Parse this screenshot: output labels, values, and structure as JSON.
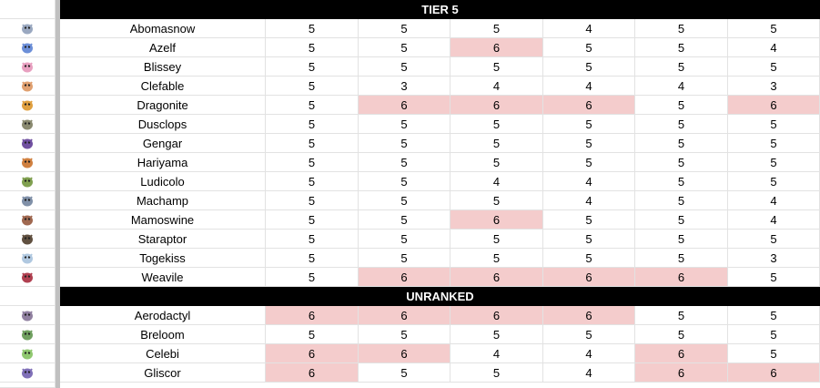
{
  "sections": [
    {
      "title": "TIER 5",
      "rows": [
        {
          "name": "Abomasnow",
          "icon": "abomasnow-icon",
          "color": "#9aa8c0",
          "values": [
            "5",
            "5",
            "5",
            "4",
            "5",
            "5"
          ],
          "highlight": [
            false,
            false,
            false,
            false,
            false,
            false
          ]
        },
        {
          "name": "Azelf",
          "icon": "azelf-icon",
          "color": "#6c8fd8",
          "values": [
            "5",
            "5",
            "6",
            "5",
            "5",
            "4"
          ],
          "highlight": [
            false,
            false,
            true,
            false,
            false,
            false
          ]
        },
        {
          "name": "Blissey",
          "icon": "blissey-icon",
          "color": "#e8a0c0",
          "values": [
            "5",
            "5",
            "5",
            "5",
            "5",
            "5"
          ],
          "highlight": [
            false,
            false,
            false,
            false,
            false,
            false
          ]
        },
        {
          "name": "Clefable",
          "icon": "clefable-icon",
          "color": "#e0a070",
          "values": [
            "5",
            "3",
            "4",
            "4",
            "4",
            "3"
          ],
          "highlight": [
            false,
            false,
            false,
            false,
            false,
            false
          ]
        },
        {
          "name": "Dragonite",
          "icon": "dragonite-icon",
          "color": "#e0a040",
          "values": [
            "5",
            "6",
            "6",
            "6",
            "5",
            "6"
          ],
          "highlight": [
            false,
            true,
            true,
            true,
            false,
            true
          ]
        },
        {
          "name": "Dusclops",
          "icon": "dusclops-icon",
          "color": "#8a8a70",
          "values": [
            "5",
            "5",
            "5",
            "5",
            "5",
            "5"
          ],
          "highlight": [
            false,
            false,
            false,
            false,
            false,
            false
          ]
        },
        {
          "name": "Gengar",
          "icon": "gengar-icon",
          "color": "#7050a0",
          "values": [
            "5",
            "5",
            "5",
            "5",
            "5",
            "5"
          ],
          "highlight": [
            false,
            false,
            false,
            false,
            false,
            false
          ]
        },
        {
          "name": "Hariyama",
          "icon": "hariyama-icon",
          "color": "#d08040",
          "values": [
            "5",
            "5",
            "5",
            "5",
            "5",
            "5"
          ],
          "highlight": [
            false,
            false,
            false,
            false,
            false,
            false
          ]
        },
        {
          "name": "Ludicolo",
          "icon": "ludicolo-icon",
          "color": "#80a050",
          "values": [
            "5",
            "5",
            "4",
            "4",
            "5",
            "5"
          ],
          "highlight": [
            false,
            false,
            false,
            false,
            false,
            false
          ]
        },
        {
          "name": "Machamp",
          "icon": "machamp-icon",
          "color": "#8090a8",
          "values": [
            "5",
            "5",
            "5",
            "4",
            "5",
            "4"
          ],
          "highlight": [
            false,
            false,
            false,
            false,
            false,
            false
          ]
        },
        {
          "name": "Mamoswine",
          "icon": "mamoswine-icon",
          "color": "#a06850",
          "values": [
            "5",
            "5",
            "6",
            "5",
            "5",
            "4"
          ],
          "highlight": [
            false,
            false,
            true,
            false,
            false,
            false
          ]
        },
        {
          "name": "Staraptor",
          "icon": "staraptor-icon",
          "color": "#605040",
          "values": [
            "5",
            "5",
            "5",
            "5",
            "5",
            "5"
          ],
          "highlight": [
            false,
            false,
            false,
            false,
            false,
            false
          ]
        },
        {
          "name": "Togekiss",
          "icon": "togekiss-icon",
          "color": "#b0c8e0",
          "values": [
            "5",
            "5",
            "5",
            "5",
            "5",
            "3"
          ],
          "highlight": [
            false,
            false,
            false,
            false,
            false,
            false
          ]
        },
        {
          "name": "Weavile",
          "icon": "weavile-icon",
          "color": "#b04050",
          "values": [
            "5",
            "6",
            "6",
            "6",
            "6",
            "5"
          ],
          "highlight": [
            false,
            true,
            true,
            true,
            true,
            false
          ]
        }
      ]
    },
    {
      "title": "UNRANKED",
      "rows": [
        {
          "name": "Aerodactyl",
          "icon": "aerodactyl-icon",
          "color": "#9080a0",
          "values": [
            "6",
            "6",
            "6",
            "6",
            "5",
            "5"
          ],
          "highlight": [
            true,
            true,
            true,
            true,
            false,
            false
          ]
        },
        {
          "name": "Breloom",
          "icon": "breloom-icon",
          "color": "#70a060",
          "values": [
            "5",
            "5",
            "5",
            "5",
            "5",
            "5"
          ],
          "highlight": [
            false,
            false,
            false,
            false,
            false,
            false
          ]
        },
        {
          "name": "Celebi",
          "icon": "celebi-icon",
          "color": "#90c870",
          "values": [
            "6",
            "6",
            "4",
            "4",
            "6",
            "5"
          ],
          "highlight": [
            true,
            true,
            false,
            false,
            true,
            false
          ]
        },
        {
          "name": "Gliscor",
          "icon": "gliscor-icon",
          "color": "#8070b8",
          "values": [
            "6",
            "5",
            "5",
            "4",
            "6",
            "6"
          ],
          "highlight": [
            true,
            false,
            false,
            false,
            true,
            true
          ]
        }
      ]
    }
  ]
}
